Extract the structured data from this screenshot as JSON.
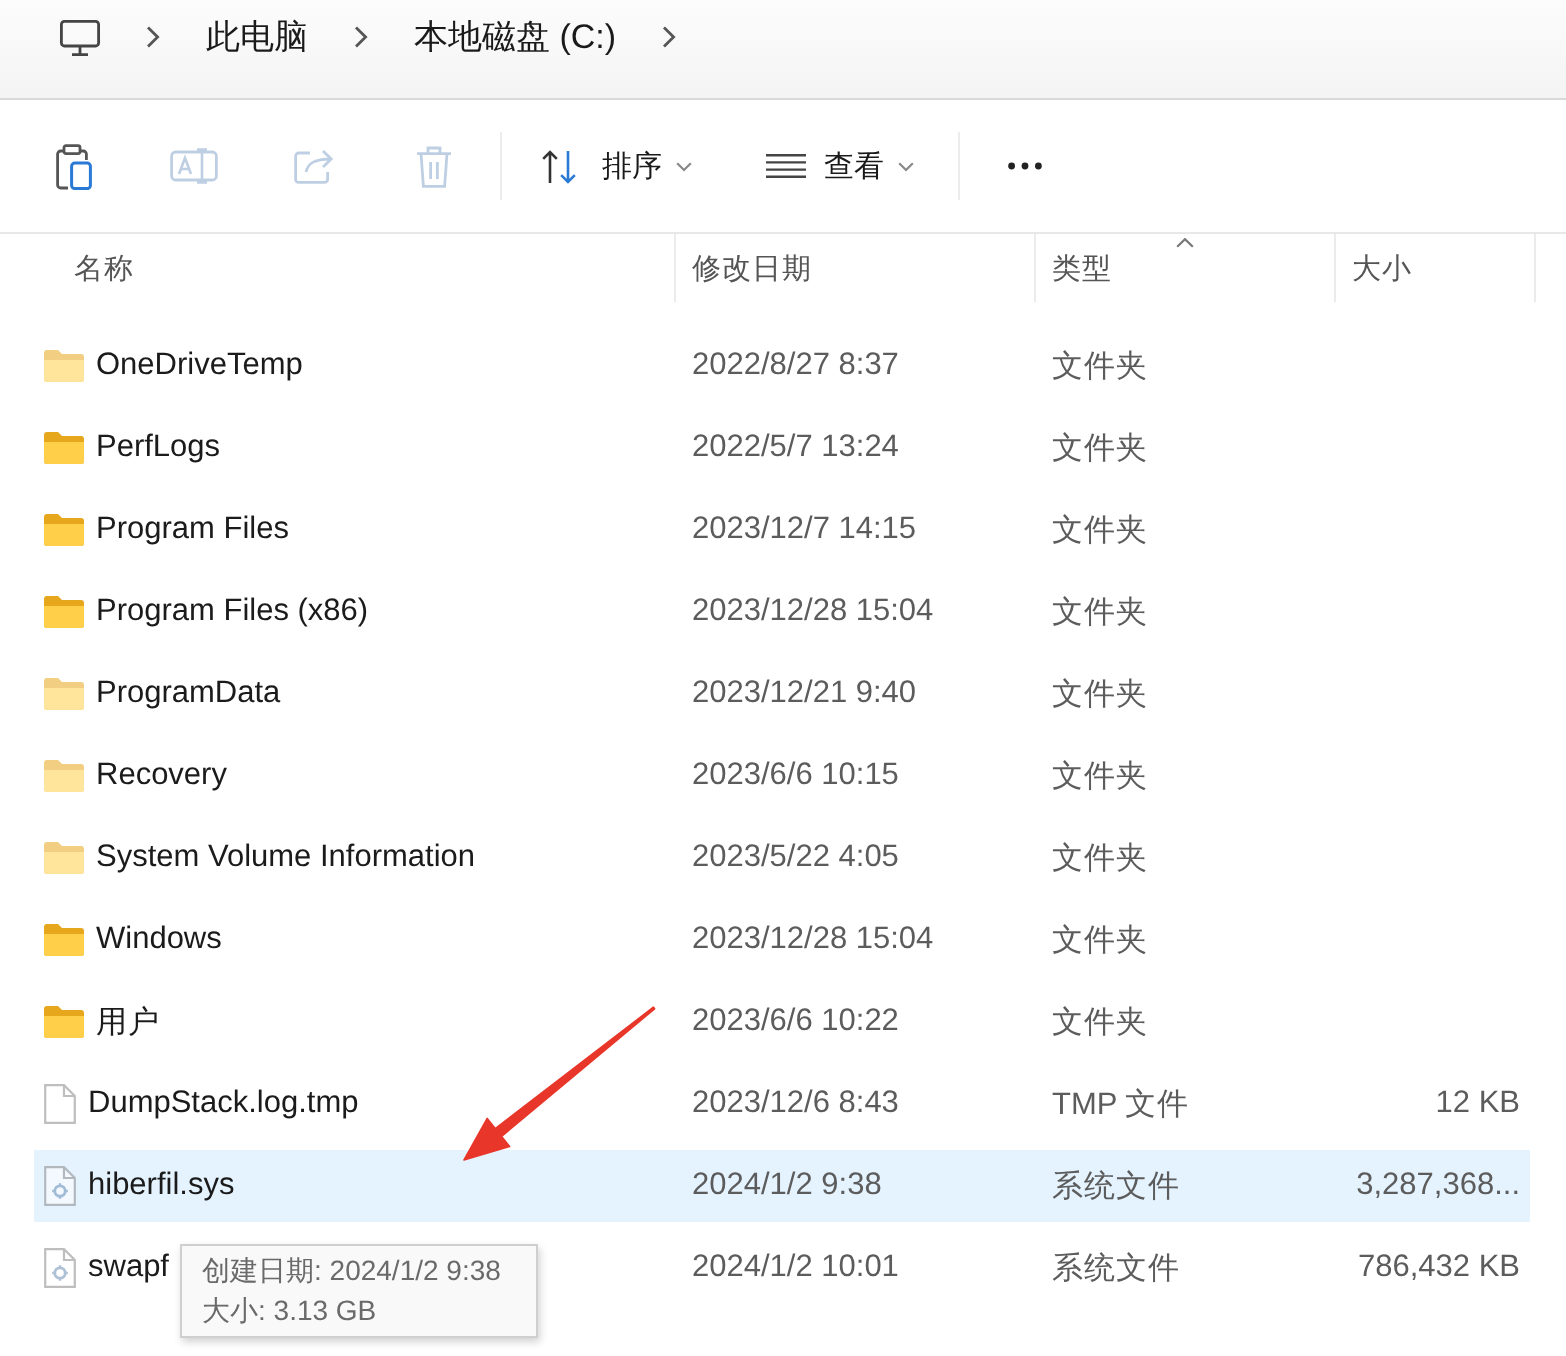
{
  "breadcrumb": {
    "items": [
      {
        "label": "此电脑"
      },
      {
        "label": "本地磁盘 (C:)"
      }
    ]
  },
  "toolbar": [
    {
      "kind": "paste",
      "disabled": false
    },
    {
      "kind": "rename",
      "disabled": true
    },
    {
      "kind": "share",
      "disabled": true
    },
    {
      "kind": "delete",
      "disabled": true
    },
    {
      "kind": "sort",
      "label": "排序"
    },
    {
      "kind": "view",
      "label": "查看"
    },
    {
      "kind": "more"
    }
  ],
  "table": {
    "columns": [
      {
        "label": "名称",
        "sorted": false
      },
      {
        "label": "修改日期",
        "sorted": false
      },
      {
        "label": "类型",
        "sorted": true
      },
      {
        "label": "大小",
        "sorted": false
      }
    ],
    "rows": [
      {
        "kind": "folder",
        "hidden": true,
        "selected": false,
        "name": "OneDriveTemp",
        "date": "2022/8/27 8:37",
        "type": "文件夹"
      },
      {
        "kind": "folder",
        "hidden": false,
        "selected": false,
        "name": "PerfLogs",
        "date": "2022/5/7 13:24",
        "type": "文件夹"
      },
      {
        "kind": "folder",
        "hidden": false,
        "selected": false,
        "name": "Program Files",
        "date": "2023/12/7 14:15",
        "type": "文件夹"
      },
      {
        "kind": "folder",
        "hidden": false,
        "selected": false,
        "name": "Program Files (x86)",
        "date": "2023/12/28 15:04",
        "type": "文件夹"
      },
      {
        "kind": "folder",
        "hidden": true,
        "selected": false,
        "name": "ProgramData",
        "date": "2023/12/21 9:40",
        "type": "文件夹"
      },
      {
        "kind": "folder",
        "hidden": true,
        "selected": false,
        "name": "Recovery",
        "date": "2023/6/6 10:15",
        "type": "文件夹"
      },
      {
        "kind": "folder",
        "hidden": true,
        "selected": false,
        "name": "System Volume Information",
        "date": "2023/5/22 4:05",
        "type": "文件夹"
      },
      {
        "kind": "folder",
        "hidden": false,
        "selected": false,
        "name": "Windows",
        "date": "2023/12/28 15:04",
        "type": "文件夹"
      },
      {
        "kind": "folder",
        "hidden": false,
        "selected": false,
        "name": "用户",
        "date": "2023/6/6 10:22",
        "type": "文件夹"
      },
      {
        "kind": "file",
        "hidden": true,
        "selected": false,
        "name": "DumpStack.log.tmp",
        "date": "2023/12/6 8:43",
        "type": "TMP 文件",
        "size": "12 KB"
      },
      {
        "kind": "system",
        "hidden": true,
        "selected": true,
        "name": "hiberfil.sys",
        "date": "2024/1/2 9:38",
        "type": "系统文件",
        "size": "3,287,368..."
      },
      {
        "kind": "system",
        "hidden": true,
        "selected": false,
        "name": "swapf",
        "date": "2024/1/2 10:01",
        "type": "系统文件",
        "size": "786,432 KB",
        "tooltip": {
          "lines": [
            "创建日期: 2024/1/2 9:38",
            "大小: 3.13 GB"
          ]
        }
      }
    ]
  }
}
